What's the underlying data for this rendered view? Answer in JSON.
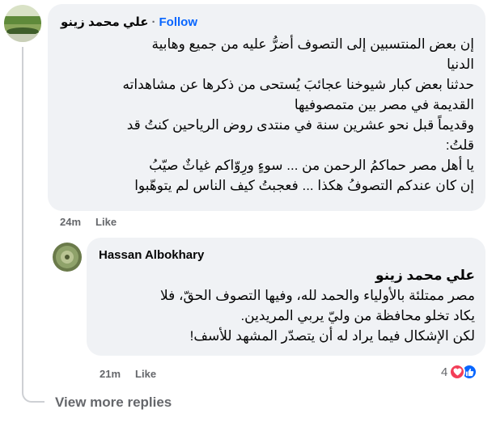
{
  "comment": {
    "author": "علي محمد زينو",
    "separator": "·",
    "follow_label": "Follow",
    "lines": [
      "إن بعض المنتسبين إلى التصوف أضرُّ عليه من جميع وهابية",
      "الدنيا",
      "حدثنا بعض كبار شيوخنا عجائبَ يُستحى من ذكرها عن مشاهداته",
      "القديمة في مصر بين متمصوفيها",
      "وقديماً قبل نحو عشرين سنة في منتدى روض الرياحين كنتُ قد",
      "قلتُ:",
      "يا أهل مصر حماكمُ الرحمن من ... سوءٍ ورِوّاكم غياثٌ صيّبُ",
      "إن كان عندكم التصوفُ هكذا ... فعجبتُ كيف الناس لم يتوهّبوا"
    ],
    "time": "24m",
    "like_label": "Like"
  },
  "reply": {
    "author": "Hassan Albokhary",
    "mention": "علي محمد زينو",
    "lines": [
      "مصر ممتلئة بالأولياء والحمد لله، وفيها التصوف الحقّ، فلا",
      "يكاد تخلو محافظة من وليّ يربي المريدين.",
      "لكن الإشكال فيما يراد له أن يتصدّر المشهد للأسف!"
    ],
    "time": "21m",
    "like_label": "Like",
    "reaction_count": "4",
    "reaction_icons": [
      "love-icon",
      "like-icon"
    ],
    "colors": {
      "love": "#f33e58",
      "like": "#0866ff"
    }
  },
  "view_more_replies": "View more replies"
}
